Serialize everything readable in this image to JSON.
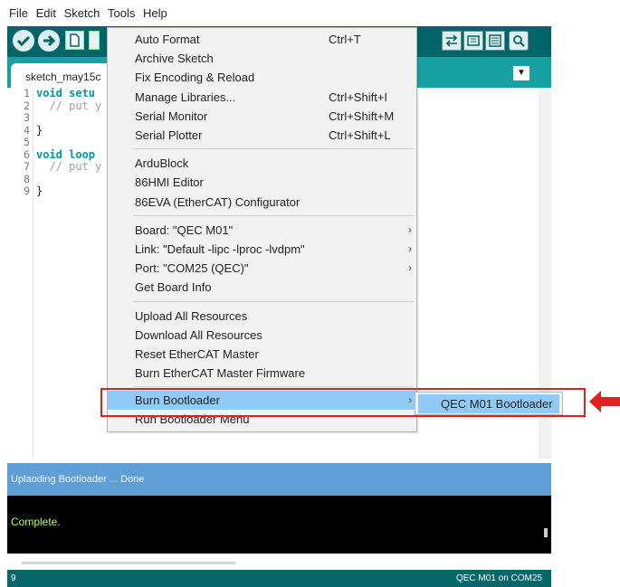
{
  "menubar": [
    "File",
    "Edit",
    "Sketch",
    "Tools",
    "Help"
  ],
  "tab": {
    "name": "sketch_may15c",
    "menu_glyph": "▼"
  },
  "code": {
    "line_numbers": [
      "1",
      "2",
      "3",
      "4",
      "5",
      "6",
      "7",
      "8",
      "9"
    ],
    "lines": [
      [
        [
          "kw",
          "void "
        ],
        [
          "kw",
          "setu"
        ]
      ],
      [
        [
          "cm",
          "  // put y"
        ]
      ],
      [],
      [
        [
          "",
          "}"
        ]
      ],
      [],
      [
        [
          "kw",
          "void "
        ],
        [
          "kw",
          "loop"
        ]
      ],
      [
        [
          "cm",
          "  // put y"
        ]
      ],
      [],
      [
        [
          "",
          "}"
        ]
      ]
    ]
  },
  "tools_menu": {
    "groups": [
      [
        {
          "label": "Auto Format",
          "shortcut": "Ctrl+T"
        },
        {
          "label": "Archive Sketch"
        },
        {
          "label": "Fix Encoding & Reload"
        },
        {
          "label": "Manage Libraries...",
          "shortcut": "Ctrl+Shift+I"
        },
        {
          "label": "Serial Monitor",
          "shortcut": "Ctrl+Shift+M"
        },
        {
          "label": "Serial Plotter",
          "shortcut": "Ctrl+Shift+L"
        }
      ],
      [
        {
          "label": "ArduBlock"
        },
        {
          "label": "86HMI Editor"
        },
        {
          "label": "86EVA (EtherCAT) Configurator"
        }
      ],
      [
        {
          "label": "Board: \"QEC M01\"",
          "submenu": true
        },
        {
          "label": "Link: \"Default -lipc -lproc -lvdpm\"",
          "submenu": true
        },
        {
          "label": "Port: \"COM25 (QEC)\"",
          "submenu": true
        },
        {
          "label": "Get Board Info"
        }
      ],
      [
        {
          "label": "Upload All Resources"
        },
        {
          "label": "Download All Resources"
        },
        {
          "label": "Reset EtherCAT Master"
        },
        {
          "label": "Burn EtherCAT Master Firmware"
        }
      ],
      [
        {
          "label": "Burn Bootloader",
          "submenu": true,
          "highlighted": true
        },
        {
          "label": "Run Bootloader Menu"
        }
      ]
    ],
    "arrow_glyph": "›"
  },
  "submenu": {
    "label": "QEC M01 Bootloader"
  },
  "status": {
    "message": "Uplaoding Bootloader ... Done"
  },
  "console": {
    "text": "Complete."
  },
  "footer": {
    "line": "9",
    "board_port": "QEC M01 on COM25"
  },
  "colors": {
    "toolbar": "#006468",
    "tabbar": "#17a1a5",
    "highlight": "#91c9f7",
    "status": "#5f9ed6",
    "console_text": "#a8ff60",
    "callout": "#e02020"
  },
  "icons": [
    "verify-icon",
    "upload-icon",
    "new-sketch-icon",
    "serial-plotter-icon",
    "serial-monitor-icon",
    "red-arrow-icon"
  ]
}
